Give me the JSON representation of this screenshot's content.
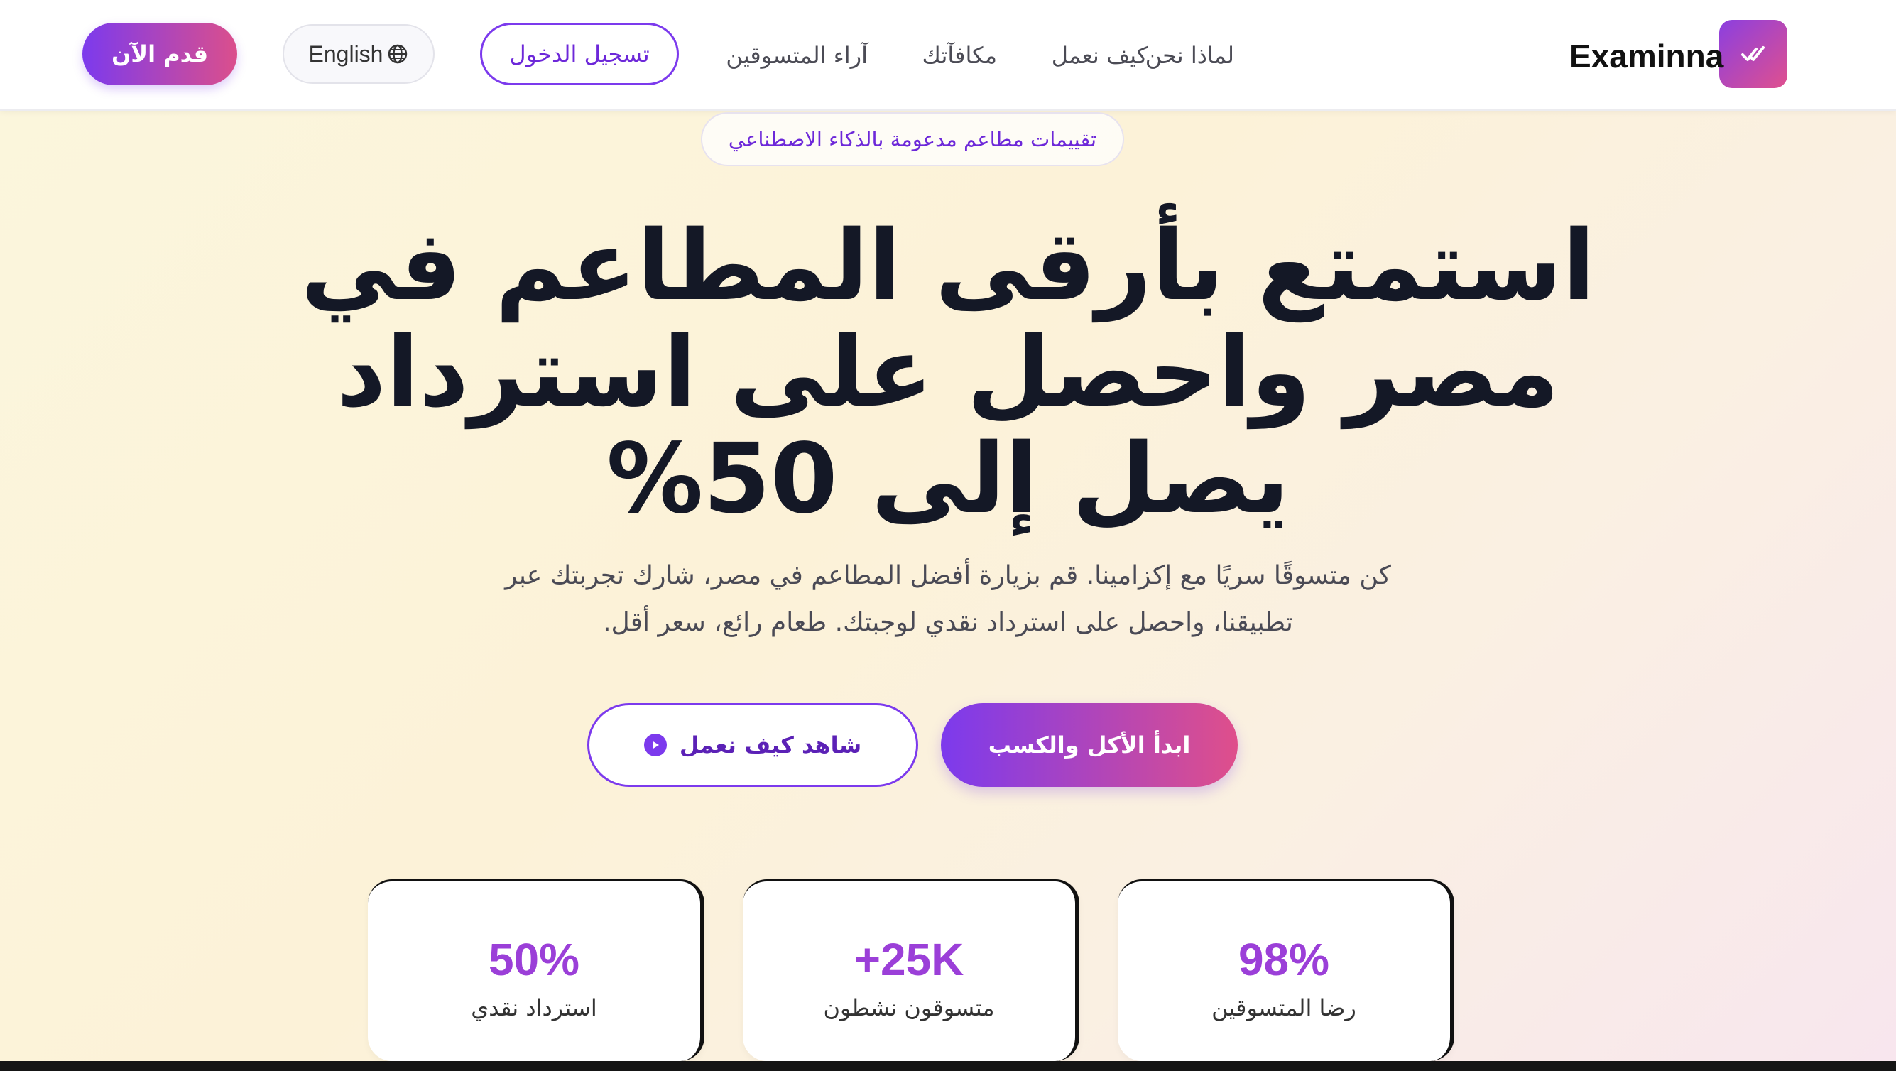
{
  "header": {
    "logo_text": "Examinna",
    "nav_links": [
      "لماذا نحن",
      "كيف نعمل",
      "مكافآتك",
      "آراء المتسوقين"
    ],
    "login_label": "تسجيل الدخول",
    "language_label": "English",
    "apply_label": "قدم الآن"
  },
  "hero": {
    "badge": "تقييمات مطاعم مدعومة بالذكاء الاصطناعي",
    "title_lines": [
      "استمتع بأرقى المطاعم في",
      "مصر واحصل على استرداد",
      "يصل إلى 50%"
    ],
    "subtitle_lines": [
      "كن متسوقًا سريًا مع إكزامينا. قم بزيارة أفضل المطاعم في مصر، شارك تجربتك عبر",
      "تطبيقنا، واحصل على استرداد نقدي لوجبتك. طعام رائع، سعر أقل."
    ],
    "cta_primary": "ابدأ الأكل والكسب",
    "cta_secondary": "شاهد كيف نعمل"
  },
  "stats": [
    {
      "value": "98%",
      "label": "رضا المتسوقين"
    },
    {
      "value": "+25K",
      "label": "متسوقون نشطون"
    },
    {
      "value": "50%",
      "label": "استرداد نقدي"
    }
  ],
  "colors": {
    "accent_purple": "#7c3aed",
    "accent_pink": "#df4f8b",
    "stat_value": "#9b3fd8",
    "heading": "#141826"
  },
  "icons": {
    "logo": "double-check-icon",
    "language": "globe-icon",
    "play": "play-circle-icon"
  }
}
